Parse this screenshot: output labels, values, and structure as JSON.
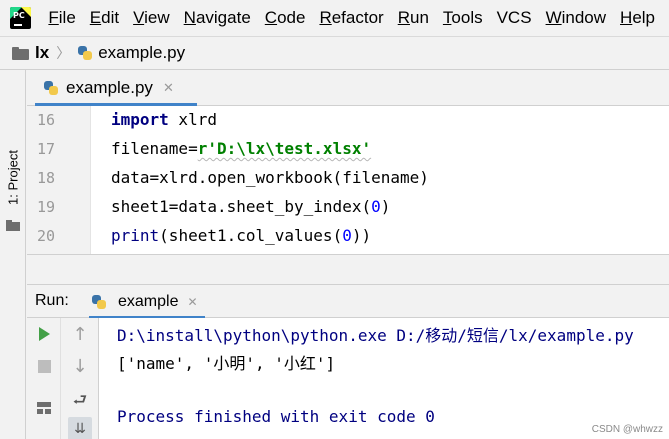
{
  "menubar": {
    "logo_text": "PC",
    "items": [
      {
        "mnemonic": "F",
        "rest": "ile"
      },
      {
        "mnemonic": "E",
        "rest": "dit"
      },
      {
        "mnemonic": "V",
        "rest": "iew"
      },
      {
        "mnemonic": "N",
        "rest": "avigate"
      },
      {
        "mnemonic": "C",
        "rest": "ode"
      },
      {
        "mnemonic": "R",
        "rest": "efactor"
      },
      {
        "mnemonic": "R",
        "rest": "un"
      },
      {
        "mnemonic": "T",
        "rest": "ools"
      },
      {
        "mnemonic": "",
        "rest": "VCS"
      },
      {
        "mnemonic": "W",
        "rest": "indow"
      },
      {
        "mnemonic": "H",
        "rest": "elp"
      }
    ]
  },
  "breadcrumb": {
    "project": "lx",
    "separator": "〉",
    "file": "example.py"
  },
  "sidebar": {
    "project_tab_label": "1: Project"
  },
  "editor_tab": {
    "label": "example.py",
    "close": "✕"
  },
  "editor": {
    "line_numbers": [
      "16",
      "17",
      "18",
      "19",
      "20"
    ],
    "lines": {
      "l16_kw": "import",
      "l16_rest": " xlrd",
      "l17_var": "filename",
      "l17_eq": "=",
      "l17_str": "r'D:\\lx\\test.xlsx'",
      "l18_text": "data=xlrd.open_workbook(filename)",
      "l19_pre": "sheet1=data.sheet_by_index(",
      "l19_num": "0",
      "l19_post": ")",
      "l20_fn": "print",
      "l20_pre": "(sheet1.col_values(",
      "l20_num": "0",
      "l20_post": "))"
    }
  },
  "run_panel": {
    "label": "Run:",
    "tab_label": "example",
    "tab_close": "✕"
  },
  "run_toolbar": {
    "rerun_icon": "play-icon",
    "stop_icon": "stop-icon",
    "layout_icon": "layout-icon",
    "up_glyph": "↑",
    "down_glyph": "↓",
    "wrap_glyph": "⮐",
    "sort_glyph": "⇊"
  },
  "console": {
    "line1": "D:\\install\\python\\python.exe D:/移动/短信/lx/example.py",
    "line2": "['name', '小明', '小红']",
    "line3": "Process finished with exit code 0"
  },
  "watermark": "CSDN @whwzz",
  "colors": {
    "accent": "#4083c9",
    "keyword": "#000080",
    "string": "#008000",
    "number": "#0000ff",
    "run_green": "#43a047"
  }
}
